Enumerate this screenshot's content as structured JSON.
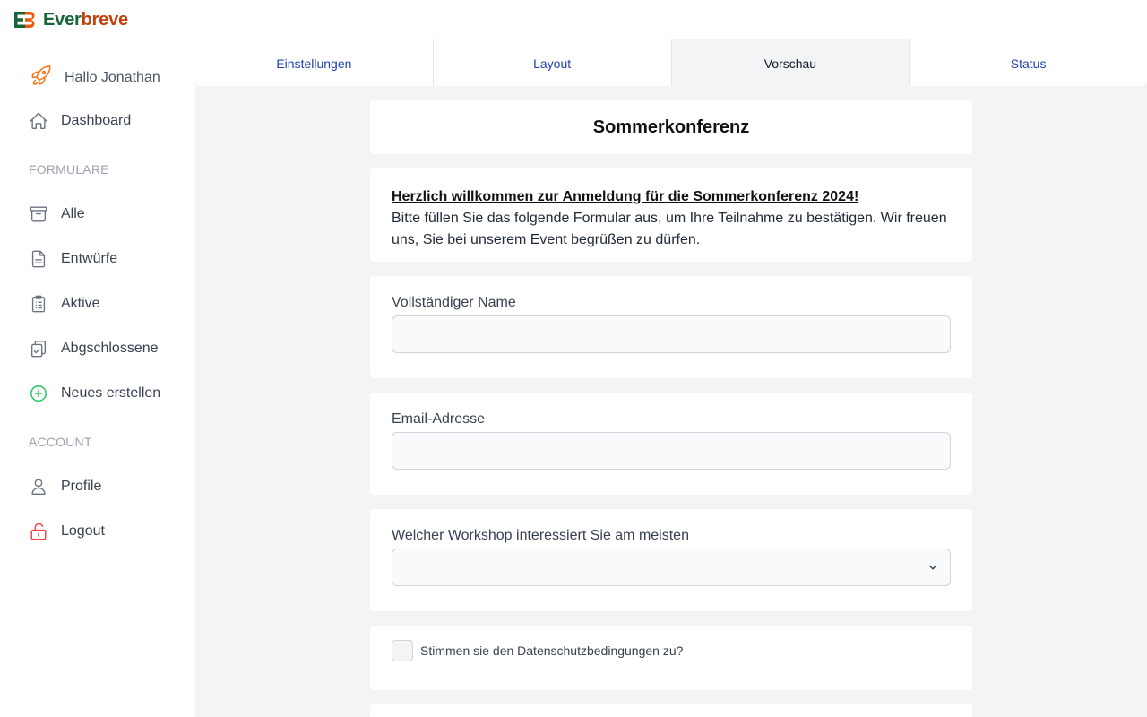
{
  "app": {
    "logo_part1": "Ever",
    "logo_part2": "breve",
    "brand_colors": {
      "green": "#166534",
      "orange": "#c2410c"
    }
  },
  "sidebar": {
    "greeting": "Hallo Jonathan",
    "dashboard": "Dashboard",
    "section_forms": "FORMULARE",
    "forms_items": [
      {
        "label": "Alle",
        "icon": "archive-box-icon"
      },
      {
        "label": "Entwürfe",
        "icon": "document-text-icon"
      },
      {
        "label": "Aktive",
        "icon": "clipboard-list-icon"
      },
      {
        "label": "Abgschlossene",
        "icon": "clipboard-check-icon"
      },
      {
        "label": "Neues erstellen",
        "icon": "plus-circle-icon"
      }
    ],
    "section_account": "ACCOUNT",
    "account_items": [
      {
        "label": "Profile",
        "icon": "user-icon"
      },
      {
        "label": "Logout",
        "icon": "lock-open-icon"
      }
    ]
  },
  "tabs": [
    {
      "label": "Einstellungen",
      "active": false
    },
    {
      "label": "Layout",
      "active": false
    },
    {
      "label": "Vorschau",
      "active": true
    },
    {
      "label": "Status",
      "active": false
    }
  ],
  "form": {
    "title": "Sommerkonferenz",
    "intro_heading": "Herzlich willkommen zur Anmeldung für die Sommerkonferenz 2024!",
    "intro_text": "Bitte füllen Sie das folgende Formular aus, um Ihre Teilnahme zu bestätigen. Wir freuen uns, Sie bei unserem Event begrüßen zu dürfen.",
    "name_label": "Vollständiger Name",
    "name_value": "",
    "email_label": "Email-Adresse",
    "email_value": "",
    "workshop_label": "Welcher Workshop interessiert Sie am meisten",
    "workshop_value": "",
    "consent_label": "Stimmen sie den Datenschutzbedingungen zu?",
    "consent_checked": false
  }
}
